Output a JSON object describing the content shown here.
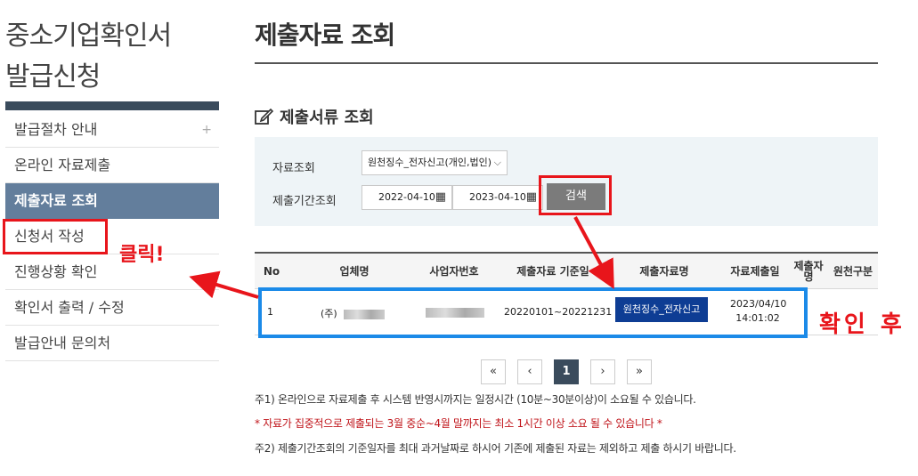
{
  "sidebar": {
    "title_line1": "중소기업확인서",
    "title_line2": "발급신청",
    "items": [
      {
        "label": "발급절차 안내",
        "plus": "+"
      },
      {
        "label": "온라인 자료제출"
      },
      {
        "label": "제출자료 조회"
      },
      {
        "label": "신청서 작성"
      },
      {
        "label": "진행상황 확인"
      },
      {
        "label": "확인서 출력 / 수정"
      },
      {
        "label": "발급안내 문의처"
      }
    ]
  },
  "page": {
    "title": "제출자료 조회"
  },
  "search": {
    "section_title": "제출서류 조회",
    "data_label": "자료조회",
    "data_value": "원천징수_전자신고(개인,법인)",
    "period_label": "제출기간조회",
    "date_from": "2022-04-10",
    "date_to": "2023-04-10",
    "search_button": "검색"
  },
  "table": {
    "headers": [
      "No",
      "업체명",
      "사업자번호",
      "제출자료 기준일",
      "제출자료명",
      "자료제출일",
      "제출자\n명",
      "원천구분"
    ],
    "rows": [
      {
        "no": "1",
        "company": "(주)",
        "period": "20220101~20221231",
        "doc": "원천징수_전자신고",
        "date": "2023/04/10",
        "time": "14:01:02"
      }
    ]
  },
  "pagination": {
    "first": "«",
    "prev": "‹",
    "current": "1",
    "next": "›",
    "last": "»"
  },
  "notes": [
    "주1) 온라인으로 자료제출 후 시스템 반영시까지는 일정시간 (10분~30분이상)이 소요될 수 있습니다.",
    "* 자료가 집중적으로 제출되는 3월 중순~4월 말까지는 최소 1시간 이상 소요 될 수 있습니다 *",
    "주2) 제출기간조회의 기준일자를 최대 과거날짜로 하시어 기존에 제출된 자료는 제외하고 제출 하시기 바랍니다."
  ],
  "annotations": {
    "click": "클릭!",
    "after": "확인 후"
  },
  "colors": {
    "active_menu": "#637e9c",
    "highlight_red": "#e8151b",
    "highlight_blue": "#1b8ae8",
    "doc_button": "#0e3d94"
  }
}
